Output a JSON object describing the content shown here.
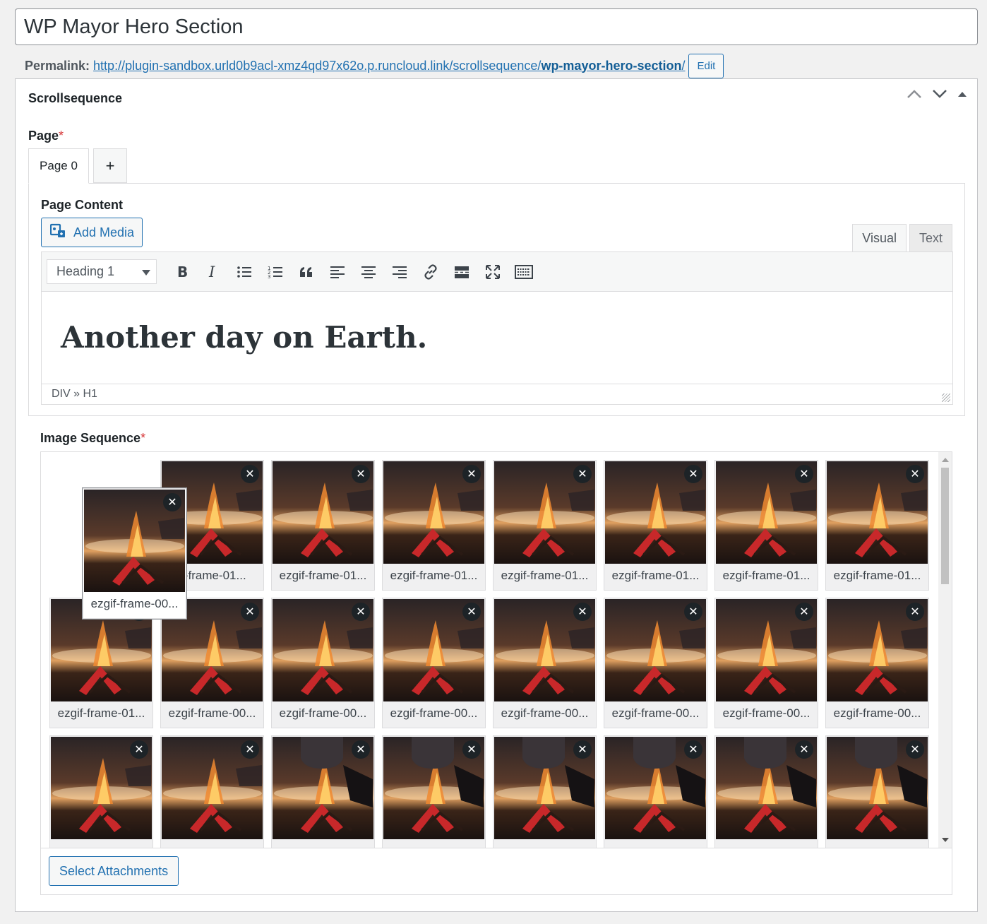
{
  "post": {
    "title": "WP Mayor Hero Section",
    "permalink_label": "Permalink:",
    "permalink_base": "http://plugin-sandbox.urld0b9acl-xmz4qd97x62o.p.runcloud.link/scrollsequence/",
    "permalink_slug": "wp-mayor-hero-section",
    "permalink_trail": "/",
    "edit_label": "Edit"
  },
  "metabox": {
    "title": "Scrollsequence",
    "page_label": "Page",
    "required_mark": "*",
    "tabs": [
      {
        "label": "Page 0"
      },
      {
        "label": "+"
      }
    ],
    "page_content_label": "Page Content",
    "add_media_label": "Add Media",
    "mode_tabs": [
      {
        "label": "Visual"
      },
      {
        "label": "Text"
      }
    ],
    "format_select": "Heading 1",
    "editor_heading": "Another day on Earth.",
    "status_path": "DIV » H1",
    "image_sequence_label": "Image Sequence",
    "select_attachments_label": "Select Attachments"
  },
  "gallery": {
    "dragging": "ezgif-frame-00...",
    "row1": [
      "if-frame-01...",
      "ezgif-frame-01...",
      "ezgif-frame-01...",
      "ezgif-frame-01...",
      "ezgif-frame-01...",
      "ezgif-frame-01...",
      "ezgif-frame-01..."
    ],
    "row2": [
      "ezgif-frame-01...",
      "ezgif-frame-00...",
      "ezgif-frame-00...",
      "ezgif-frame-00...",
      "ezgif-frame-00...",
      "ezgif-frame-00...",
      "ezgif-frame-00...",
      "ezgif-frame-00..."
    ],
    "row3": [
      "",
      "",
      "",
      "",
      "",
      "",
      "",
      ""
    ],
    "remove_glyph": "✕"
  },
  "colors": {
    "accent": "#2271b1",
    "required": "#d63638",
    "remove_badge": "#1d2327"
  }
}
